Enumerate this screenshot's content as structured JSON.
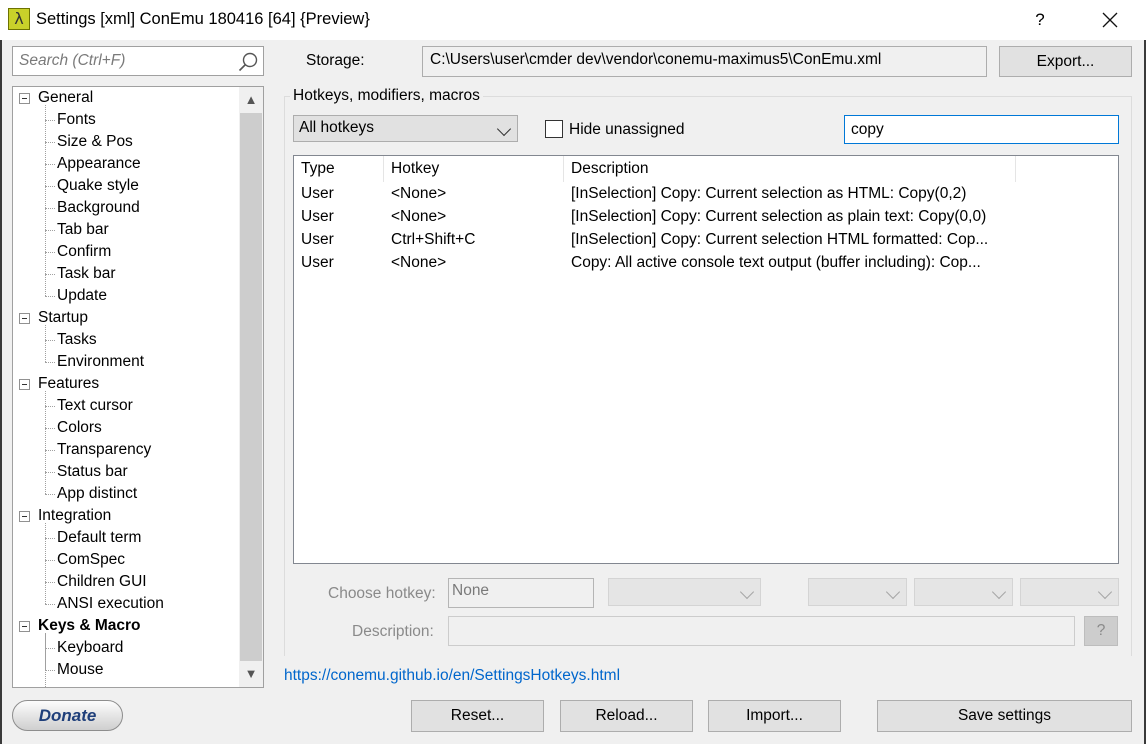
{
  "window": {
    "title": "Settings [xml] ConEmu 180416 [64] {Preview}",
    "app_icon_glyph": "λ",
    "help_glyph": "?"
  },
  "search": {
    "placeholder": "Search (Ctrl+F)"
  },
  "tree": {
    "items": [
      {
        "label": "General",
        "level": 0,
        "expanded": true
      },
      {
        "label": "Fonts",
        "level": 1
      },
      {
        "label": "Size & Pos",
        "level": 1
      },
      {
        "label": "Appearance",
        "level": 1
      },
      {
        "label": "Quake style",
        "level": 1
      },
      {
        "label": "Background",
        "level": 1
      },
      {
        "label": "Tab bar",
        "level": 1
      },
      {
        "label": "Confirm",
        "level": 1
      },
      {
        "label": "Task bar",
        "level": 1
      },
      {
        "label": "Update",
        "level": 1
      },
      {
        "label": "Startup",
        "level": 0,
        "expanded": true
      },
      {
        "label": "Tasks",
        "level": 1
      },
      {
        "label": "Environment",
        "level": 1
      },
      {
        "label": "Features",
        "level": 0,
        "expanded": true
      },
      {
        "label": "Text cursor",
        "level": 1
      },
      {
        "label": "Colors",
        "level": 1
      },
      {
        "label": "Transparency",
        "level": 1
      },
      {
        "label": "Status bar",
        "level": 1
      },
      {
        "label": "App distinct",
        "level": 1
      },
      {
        "label": "Integration",
        "level": 0,
        "expanded": true
      },
      {
        "label": "Default term",
        "level": 1
      },
      {
        "label": "ComSpec",
        "level": 1
      },
      {
        "label": "Children GUI",
        "level": 1
      },
      {
        "label": "ANSI execution",
        "level": 1
      },
      {
        "label": "Keys & Macro",
        "level": 0,
        "expanded": true,
        "selected": true
      },
      {
        "label": "Keyboard",
        "level": 1
      },
      {
        "label": "Mouse",
        "level": 1
      }
    ]
  },
  "donate_label": "Donate",
  "storage": {
    "label": "Storage:",
    "path": "C:\\Users\\user\\cmder dev\\vendor\\conemu-maximus5\\ConEmu.xml",
    "export_label": "Export..."
  },
  "hotkeys": {
    "group_title": "Hotkeys, modifiers, macros",
    "filter_selected": "All hotkeys",
    "hide_unassigned_label": "Hide unassigned",
    "hide_unassigned_checked": false,
    "filter_text": "copy",
    "columns": [
      "Type",
      "Hotkey",
      "Description"
    ],
    "rows": [
      {
        "type": "User",
        "hotkey": "<None>",
        "description": "[InSelection] Copy: Current selection as HTML: Copy(0,2)"
      },
      {
        "type": "User",
        "hotkey": "<None>",
        "description": "[InSelection] Copy: Current selection as plain text: Copy(0,0)"
      },
      {
        "type": "User",
        "hotkey": "Ctrl+Shift+C",
        "description": "[InSelection] Copy: Current selection HTML formatted: Cop..."
      },
      {
        "type": "User",
        "hotkey": "<None>",
        "description": "Copy: All active console text output (buffer including): Cop..."
      }
    ],
    "choose_hotkey_label": "Choose hotkey:",
    "choose_hotkey_value": "None",
    "description_label": "Description:",
    "description_help": "?"
  },
  "help_link": "https://conemu.github.io/en/SettingsHotkeys.html",
  "buttons": {
    "reset": "Reset...",
    "reload": "Reload...",
    "import": "Import...",
    "save": "Save settings"
  }
}
